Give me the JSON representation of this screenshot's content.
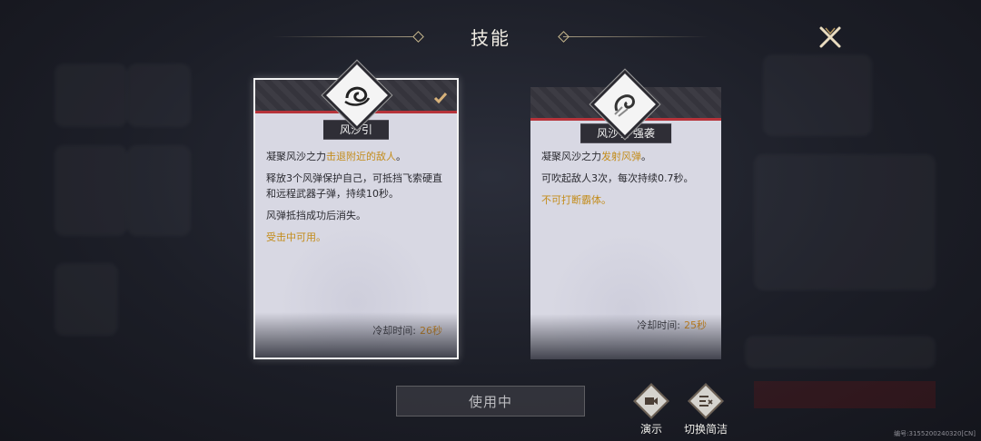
{
  "header": {
    "title": "技能"
  },
  "skills": [
    {
      "name": "风沙引",
      "selected": true,
      "description": [
        [
          {
            "text": "凝聚风沙之力",
            "hl": false
          },
          {
            "text": "击退附近的敌人",
            "hl": true
          },
          {
            "text": "。",
            "hl": false
          }
        ],
        [
          {
            "text": "释放3个风弹保护自己，可抵挡飞索硬直和远程武器子弹，持续10秒。",
            "hl": false
          }
        ],
        [
          {
            "text": "风弹抵挡成功后消失。",
            "hl": false
          }
        ],
        [
          {
            "text": "受击中可用。",
            "hl": true
          }
        ]
      ],
      "cooldown_label": "冷却时间:",
      "cooldown_value": "26秒"
    },
    {
      "name": "风沙引·强袭",
      "selected": false,
      "description": [
        [
          {
            "text": "凝聚风沙之力",
            "hl": false
          },
          {
            "text": "发射风弹",
            "hl": true
          },
          {
            "text": "。",
            "hl": false
          }
        ],
        [
          {
            "text": "可吹起敌人3次，每次持续0.7秒。",
            "hl": false
          }
        ],
        [
          {
            "text": "不可打断霸体。",
            "hl": true
          }
        ]
      ],
      "cooldown_label": "冷却时间:",
      "cooldown_value": "25秒"
    }
  ],
  "controls": {
    "use_label": "使用中",
    "demo_label": "演示",
    "toggle_label": "切换简洁"
  },
  "footer": {
    "build_text": "编号:3155200240320[CN]"
  },
  "colors": {
    "highlight": "#c38c1a",
    "cooldown": "#d28a1e",
    "accent_red": "#b6333a"
  }
}
